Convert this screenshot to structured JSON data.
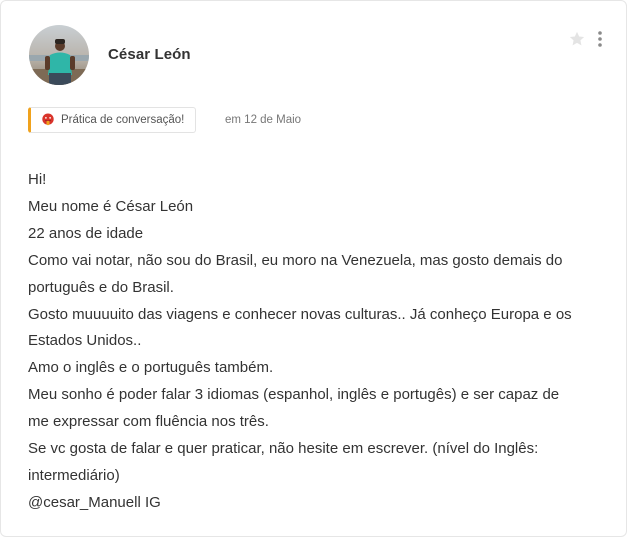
{
  "post": {
    "author": {
      "name": "César León",
      "avatar_icon": "user-photo"
    },
    "actions": {
      "star_icon": "star-icon",
      "more_icon": "vertical-ellipsis-icon"
    },
    "tag": {
      "label": "Prática de conversação!",
      "icon": "tongue-face-icon",
      "accent_color": "#f0a21d"
    },
    "date": "em 12 de Maio",
    "body_lines": [
      "Hi!",
      "Meu nome é César León",
      "22 anos de idade",
      "Como vai notar, não sou do Brasil, eu moro na Venezuela, mas gosto demais do",
      "português e do Brasil.",
      "Gosto muuuuito das viagens e conhecer novas culturas.. Já conheço Europa e os",
      "Estados Unidos..",
      "Amo o inglês e o português também.",
      "Meu sonho é poder falar 3 idiomas (espanhol, inglês e portugês) e ser capaz de",
      "me expressar com fluência nos três.",
      "Se vc gosta de falar e quer praticar, não hesite em escrever. (nível do Inglês:",
      "intermediário)",
      "@cesar_Manuell IG"
    ]
  }
}
